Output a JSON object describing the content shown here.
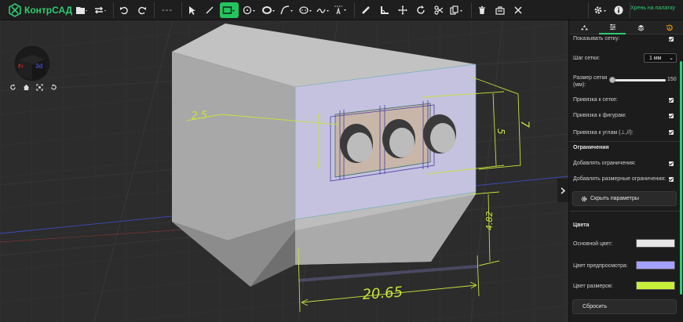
{
  "app": {
    "brand": "КонтрСАД",
    "mode_link": "Хрень на палатку"
  },
  "toolbar": {
    "icons": [
      "folder-icon",
      "swap-icon",
      "undo-icon",
      "redo-icon",
      "dash-icon",
      "pointer-icon",
      "line-icon",
      "rectangle-icon",
      "circle-icon",
      "ellipse-icon",
      "curve-icon",
      "polygon-icon",
      "spline-icon",
      "text-icon",
      "ruler-icon",
      "angle-icon",
      "move-icon",
      "rotate-icon",
      "scissors-icon",
      "copy-icon",
      "trash-icon",
      "camera-icon",
      "close-icon",
      "settings-icon",
      "info-icon"
    ],
    "dashes": "---",
    "active_tool": "rectangle-icon"
  },
  "viewport": {
    "view_cube_label": "3d",
    "dimensions": [
      "2.5",
      "5",
      "7",
      "4.82",
      "20.65"
    ]
  },
  "panel": {
    "tabs": [
      "layers-tab",
      "settings-tab",
      "stack-tab",
      "history-tab"
    ],
    "active_tab": "settings-tab",
    "show_grid_label": "Показывать сетку:",
    "grid_step_label": "Шаг сетки:",
    "grid_step_value": "1 мм",
    "grid_size_label": "Размер сетки (мм):",
    "grid_size_value": "150",
    "snap_grid_label": "Привязка к сетке:",
    "snap_shapes_label": "Привязка к фигурам:",
    "snap_angles_label": "Привязка к углам (⊥,//):",
    "constraints_title": "Ограничения",
    "add_constraints_label": "Добавлять ограничения:",
    "add_dim_constraints_label": "Добавлять размерные ограничения:",
    "hide_params_button": "Скрыть параметры",
    "colors_title": "Цвета",
    "main_color_label": "Основной цвет:",
    "preview_color_label": "Цвет предпросмотра:",
    "dim_color_label": "Цвет размеров:",
    "reset_button": "Сбросить",
    "colors": {
      "main": "#e6e6e6",
      "preview": "#a5a1ff",
      "dimensions": "#c8f03a"
    }
  },
  "colors": {
    "accent": "#22c55e",
    "toolbar_bg": "#1e1e1e",
    "viewport_bg": "#2c2c2c"
  }
}
